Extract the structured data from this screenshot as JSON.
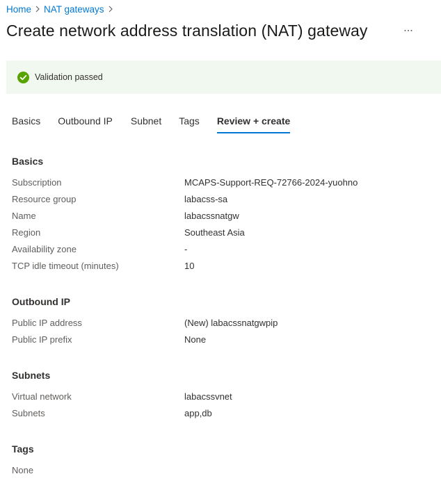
{
  "breadcrumb": {
    "home": "Home",
    "nat_gateways": "NAT gateways"
  },
  "page": {
    "title": "Create network address translation (NAT) gateway",
    "more_label": "⋯"
  },
  "banner": {
    "message": "Validation passed"
  },
  "tabs": [
    {
      "label": "Basics"
    },
    {
      "label": "Outbound IP"
    },
    {
      "label": "Subnet"
    },
    {
      "label": "Tags"
    },
    {
      "label": "Review + create",
      "active": true
    }
  ],
  "basics": {
    "heading": "Basics",
    "rows": [
      {
        "label": "Subscription",
        "value": "MCAPS-Support-REQ-72766-2024-yuohno"
      },
      {
        "label": "Resource group",
        "value": "labacss-sa"
      },
      {
        "label": "Name",
        "value": "labacssnatgw"
      },
      {
        "label": "Region",
        "value": "Southeast Asia"
      },
      {
        "label": "Availability zone",
        "value": "-"
      },
      {
        "label": "TCP idle timeout (minutes)",
        "value": "10"
      }
    ]
  },
  "outbound_ip": {
    "heading": "Outbound IP",
    "rows": [
      {
        "label": "Public IP address",
        "value": "(New) labacssnatgwpip"
      },
      {
        "label": "Public IP prefix",
        "value": "None"
      }
    ]
  },
  "subnets": {
    "heading": "Subnets",
    "rows": [
      {
        "label": "Virtual network",
        "value": "labacssvnet"
      },
      {
        "label": "Subnets",
        "value": "app,db"
      }
    ]
  },
  "tags": {
    "heading": "Tags",
    "value": "None"
  },
  "colors": {
    "link": "#0078d4",
    "success": "#57a300",
    "banner_bg": "#f1f8ef"
  }
}
